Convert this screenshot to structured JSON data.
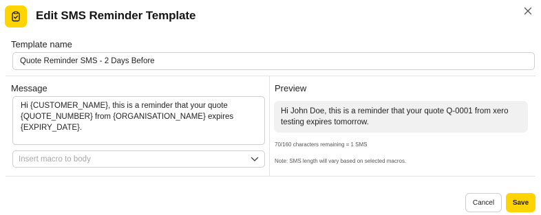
{
  "dialog": {
    "title": "Edit SMS Reminder Template",
    "icon": "clipboard-check-icon",
    "close_icon": "close-icon",
    "accent_color": "#ffd400"
  },
  "template_name": {
    "label": "Template name",
    "value": "Quote Reminder SMS - 2 Days Before"
  },
  "message": {
    "label": "Message",
    "body": "Hi {CUSTOMER_NAME}, this is a reminder that your quote {QUOTE_NUMBER} from {ORGANISATION_NAME} expires {EXPIRY_DATE}.",
    "macro_placeholder": "Insert macro to body",
    "macro_icon": "chevron-down-icon"
  },
  "preview": {
    "label": "Preview",
    "text": "Hi John Doe, this is a reminder that your quote Q-0001 from xero testing expires tomorrow.",
    "chars_remaining": "70/160 characters remaining = 1 SMS",
    "note": "Note: SMS length will vary based on selected macros."
  },
  "footer": {
    "cancel_label": "Cancel",
    "save_label": "Save"
  }
}
